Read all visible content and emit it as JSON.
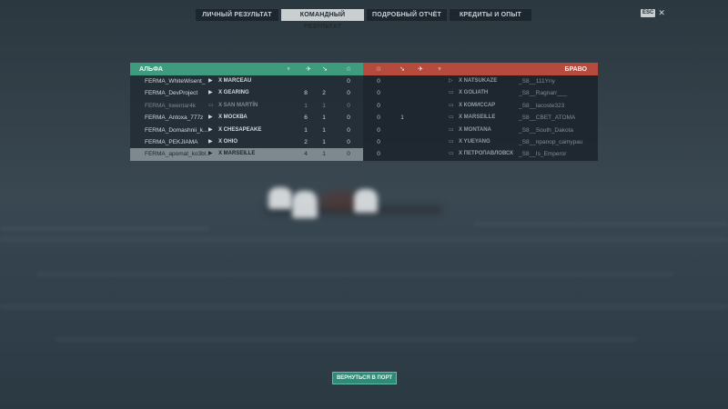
{
  "tabs": [
    {
      "label": "ЛИЧНЫЙ РЕЗУЛЬТАТ",
      "active": false
    },
    {
      "label": "КОМАНДНЫЙ РЕЗУЛЬТАТ",
      "active": true
    },
    {
      "label": "ПОДРОБНЫЙ ОТЧЁТ",
      "active": false
    },
    {
      "label": "КРЕДИТЫ И ОПЫТ",
      "active": false
    }
  ],
  "corner": {
    "key_hint": "ESC",
    "close_icon": "close-icon"
  },
  "teams": {
    "left_name": "АЛЬФА",
    "right_name": "БРАВО",
    "left_color": "#3e9b7e",
    "right_color": "#b54a3d"
  },
  "columns": {
    "icons": [
      "laurel-icon",
      "planes-icon",
      "torpedo-icon",
      "star-icon"
    ]
  },
  "left_rows": [
    {
      "player": "FERMA_WhiteWisent_",
      "ship": "X MARCEAU",
      "c1": "",
      "c2": "",
      "c3": "",
      "c4": "0",
      "state": "normal"
    },
    {
      "player": "FERMA_DevProject",
      "ship": "X GEARING",
      "c1": "",
      "c2": "8",
      "c3": "2",
      "c4": "0",
      "state": "normal"
    },
    {
      "player": "FERMA_kwentar4k",
      "ship": "X SAN MARTÍN",
      "c1": "",
      "c2": "1",
      "c3": "1",
      "c4": "0",
      "state": "dead"
    },
    {
      "player": "FERMA_Antoxa_777z",
      "ship": "X МОСКВА",
      "c1": "",
      "c2": "6",
      "c3": "1",
      "c4": "0",
      "state": "normal"
    },
    {
      "player": "FERMA_Domashnii_k...",
      "ship": "X CHESAPEAKE",
      "c1": "",
      "c2": "1",
      "c3": "1",
      "c4": "0",
      "state": "normal"
    },
    {
      "player": "FERMA_PEKJIAMA",
      "ship": "X OHIO",
      "c1": "",
      "c2": "2",
      "c3": "1",
      "c4": "0",
      "state": "normal"
    },
    {
      "player": "FERMA_apomat_ko3bl...",
      "ship": "X MARSEILLE",
      "c1": "",
      "c2": "4",
      "c3": "1",
      "c4": "0",
      "state": "me"
    }
  ],
  "right_rows": [
    {
      "c1": "0",
      "c2": "",
      "ship": "X NATSUKAZE",
      "player": "_S8__111Yny"
    },
    {
      "c1": "0",
      "c2": "",
      "ship": "X GOLIATH",
      "player": "_S8__Ragnarr___"
    },
    {
      "c1": "0",
      "c2": "",
      "ship": "X КОМИССАР",
      "player": "_S8__lacoste323"
    },
    {
      "c1": "0",
      "c2": "1",
      "ship": "X MARSEILLE",
      "player": "_S8__CBET_ATOMA"
    },
    {
      "c1": "0",
      "c2": "",
      "ship": "X MONTANA",
      "player": "_S8__South_Dakota"
    },
    {
      "c1": "0",
      "c2": "",
      "ship": "X YUEYANG",
      "player": "_S8__npanop_camypau"
    },
    {
      "c1": "0",
      "c2": "",
      "ship": "X ПЕТРОПАВЛОВСК",
      "player": "_S8__Is_Emperor"
    }
  ],
  "return_button": "ВЕРНУТЬСЯ В ПОРТ"
}
